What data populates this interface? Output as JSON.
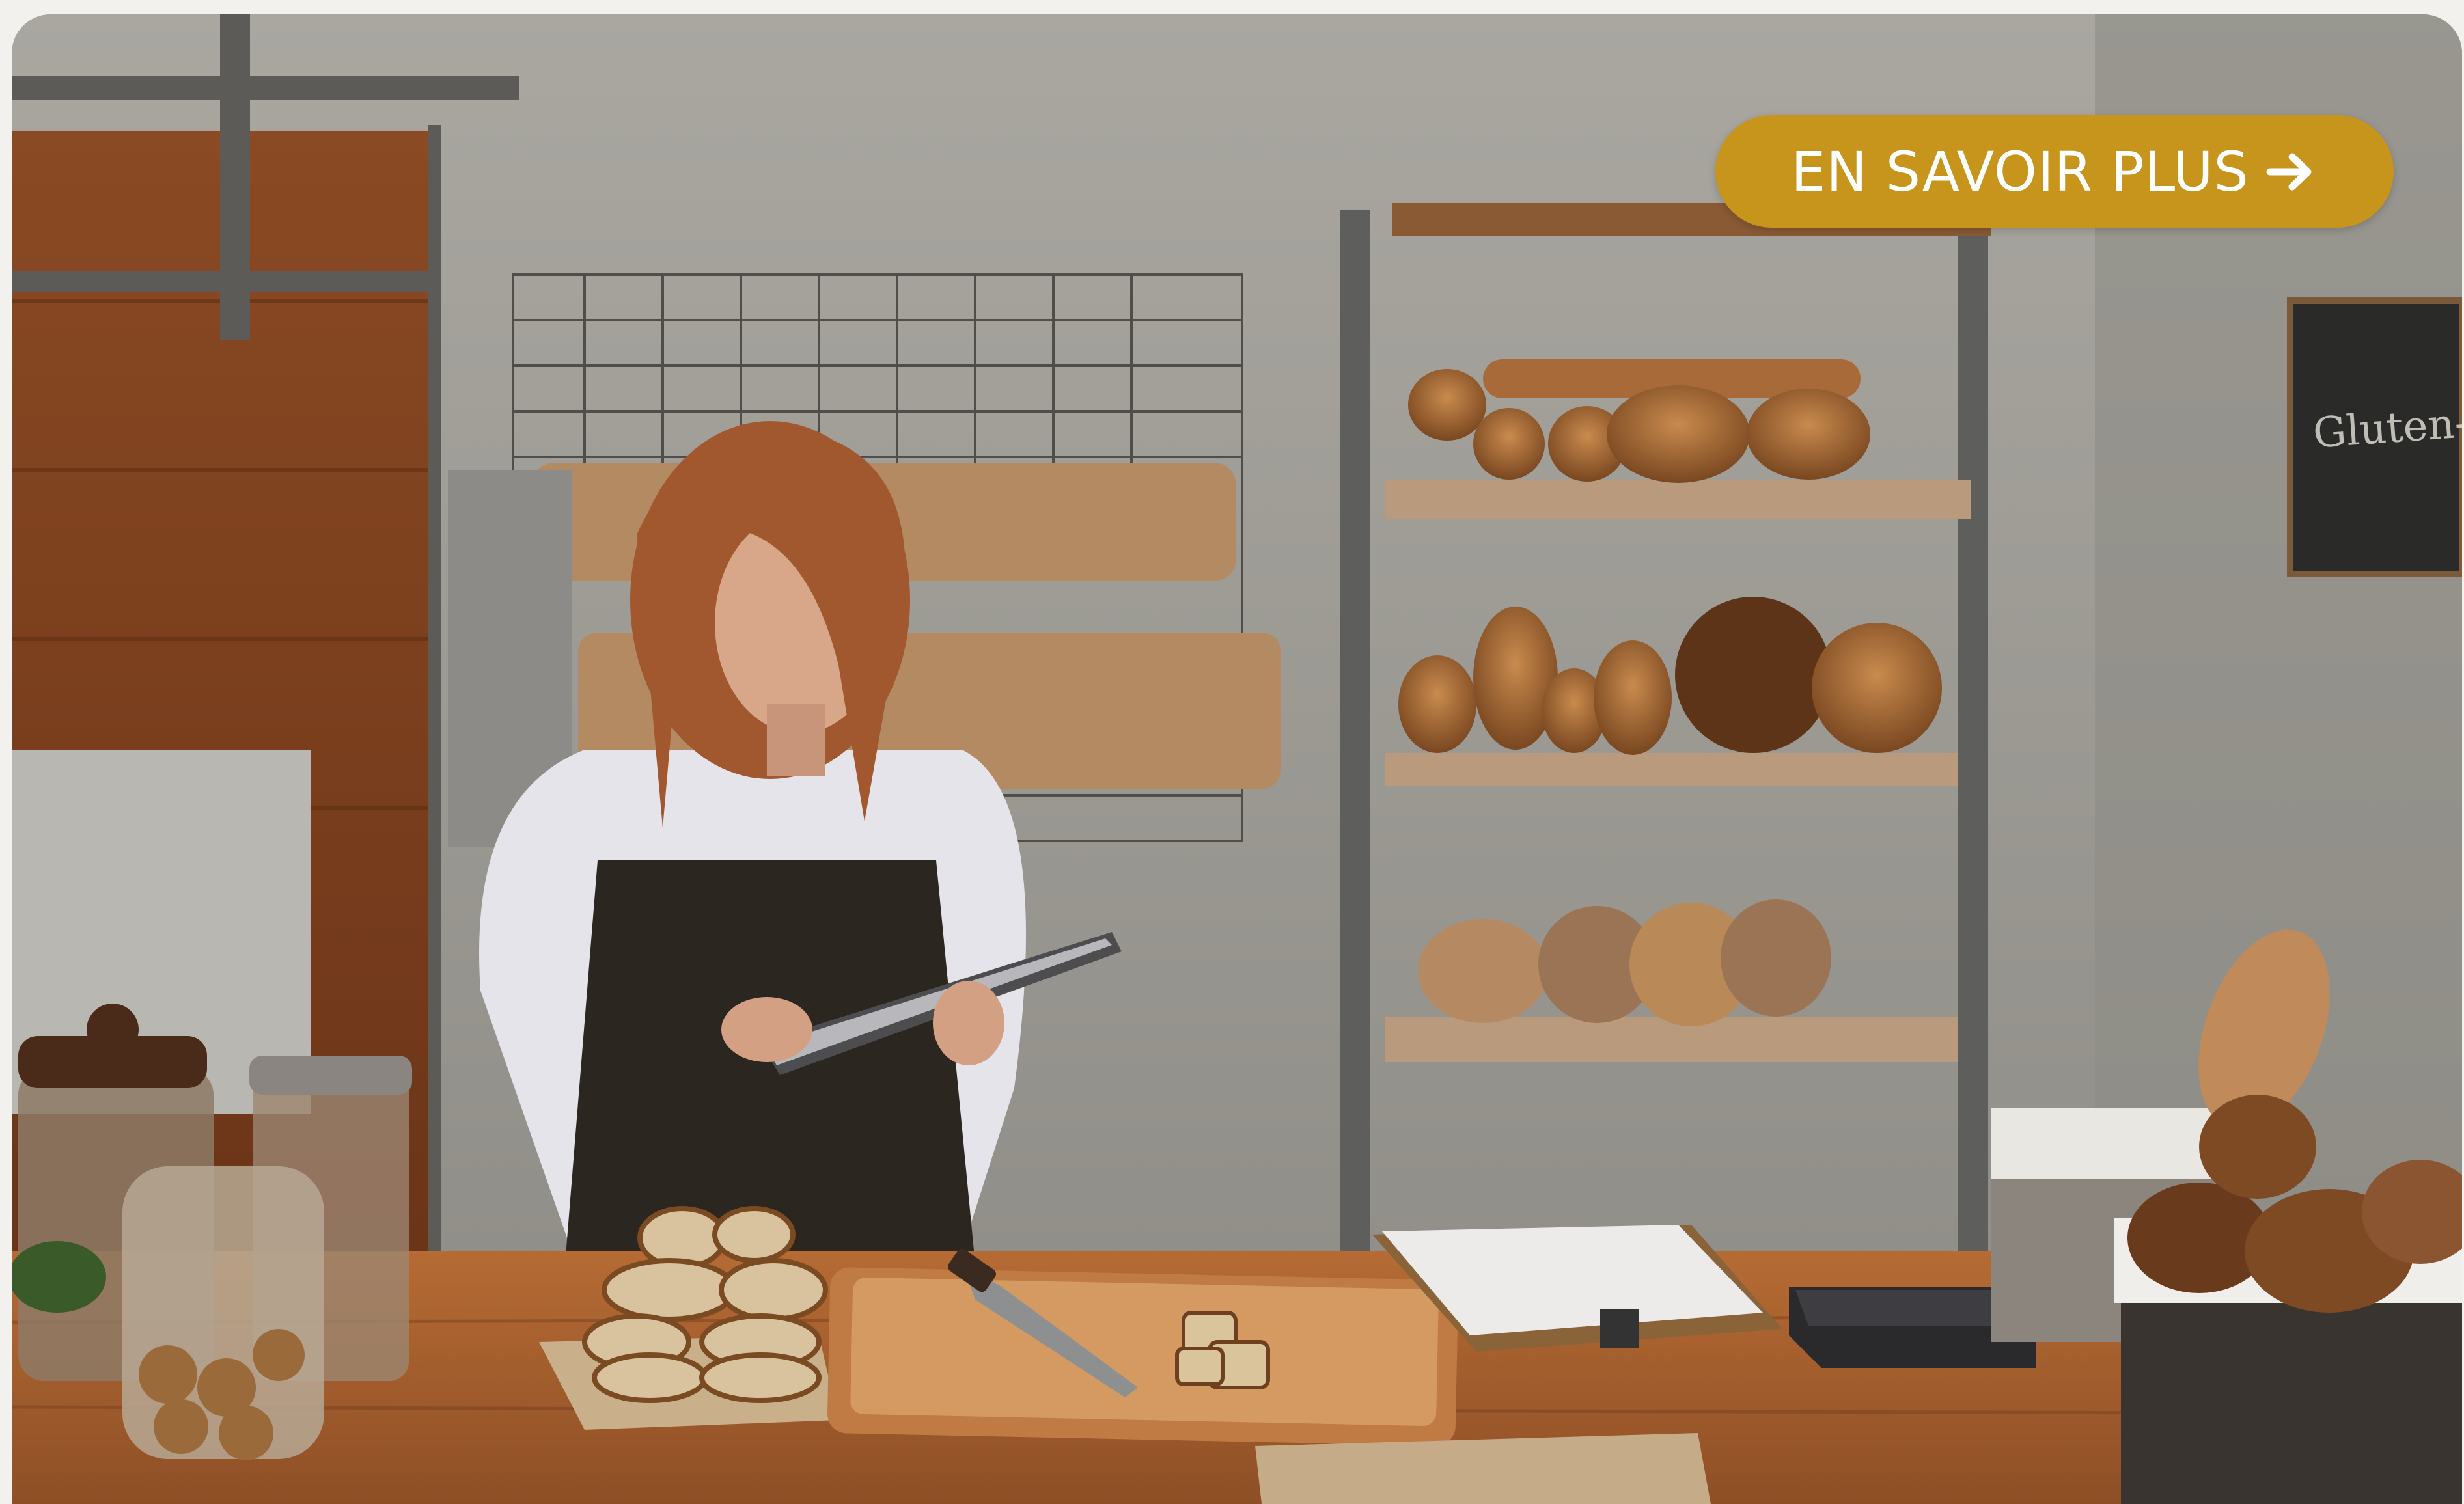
{
  "cta": {
    "label": "EN SAVOIR PLUS",
    "icon": "arrow-right-icon"
  },
  "chalkboard": {
    "text": "Gluten-free"
  },
  "colors": {
    "accent": "#c7951c",
    "card_background": "#9e9c95",
    "page_background": "#f3f1ee"
  }
}
